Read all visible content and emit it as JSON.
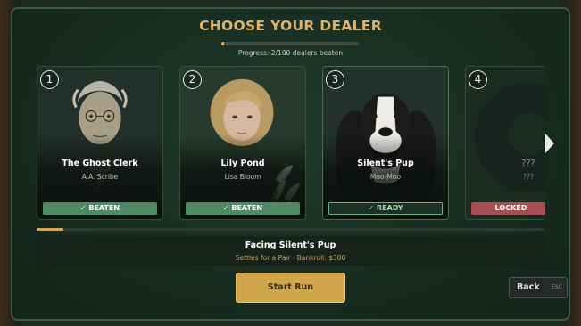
{
  "header": {
    "title": "CHOOSE YOUR DEALER",
    "progress_text": "Progress: 2/100 dealers beaten",
    "progress_fraction": 0.02
  },
  "dealers": [
    {
      "number": "1",
      "name": "The Ghost Clerk",
      "author": "A.A. Scribe",
      "status": "✓ BEATEN"
    },
    {
      "number": "2",
      "name": "Lily Pond",
      "author": "Lisa Bloom",
      "status": "✓ BEATEN"
    },
    {
      "number": "3",
      "name": "Silent's Pup",
      "author": "Moo-Moo",
      "status": "✓ READY"
    },
    {
      "number": "4",
      "name": "???",
      "author": "???",
      "status": "LOCKED"
    }
  ],
  "selection": {
    "facing": "Facing  Silent's Pup",
    "details": "Settles for a Pair  ·  Bankroll: $300"
  },
  "buttons": {
    "start": "Start Run",
    "back": "Back",
    "back_hint": "ESC"
  },
  "colors": {
    "accent_gold": "#e0b36a",
    "beaten_green": "#4e8a63",
    "locked_red": "#a94e4e",
    "panel_green": "#16291e"
  }
}
